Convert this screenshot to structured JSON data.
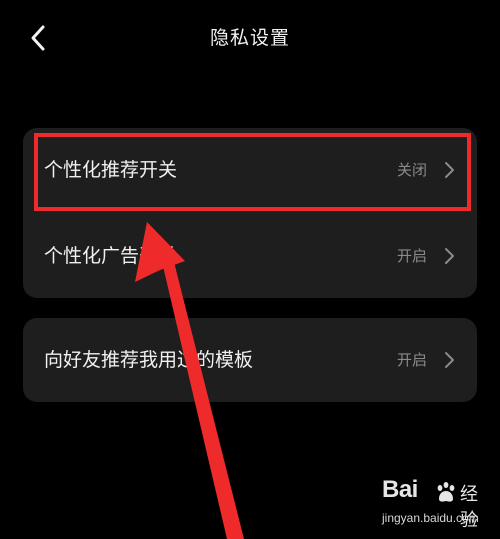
{
  "header": {
    "title": "隐私设置",
    "back_icon": "chevron-left-icon"
  },
  "settings": {
    "groups": [
      {
        "rows": [
          {
            "label": "个性化推荐开关",
            "value": "关闭"
          },
          {
            "label": "个性化广告开关",
            "value": "开启"
          }
        ]
      },
      {
        "rows": [
          {
            "label": "向好友推荐我用过的模板",
            "value": "开启"
          }
        ]
      }
    ]
  },
  "annotation": {
    "highlight_color": "#ee2a2a",
    "arrow_color": "#ee2a2a"
  },
  "watermark": {
    "logo": "Bai",
    "brand": "经验",
    "domain": "jingyan.baidu.com"
  },
  "colors": {
    "background": "#000000",
    "card": "#1e1e1e",
    "text": "#f0f0f0",
    "secondary_text": "#8a8a8a"
  }
}
